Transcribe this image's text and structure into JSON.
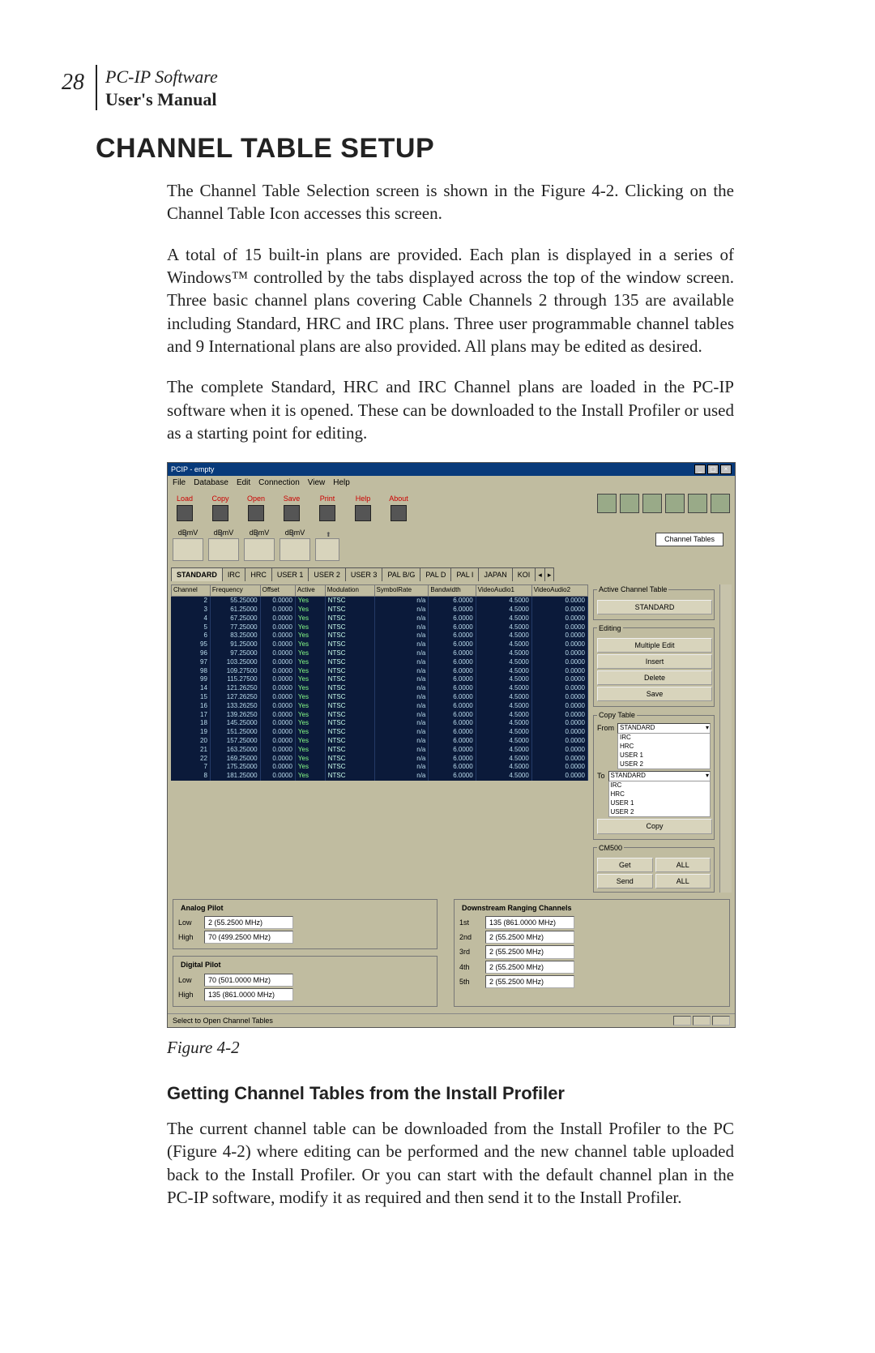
{
  "page_number": "28",
  "header": {
    "software": "PC-IP Software",
    "manual": "User's Manual"
  },
  "title": "CHANNEL TABLE SETUP",
  "paras": {
    "p1": "The Channel Table Selection screen is shown in the Figure 4-2. Clicking on the Channel Table Icon accesses this screen.",
    "p2": "A total of 15 built-in plans are provided. Each plan is displayed in a series of Windows™ controlled by the tabs displayed across the top of the window screen. Three basic channel plans covering Cable Channels 2 through 135 are available including Standard, HRC and IRC plans. Three user programmable channel tables and 9 International plans are also provided. All plans may be edited as desired.",
    "p3": "The complete Standard, HRC and IRC Channel plans are loaded in the PC-IP software when it is opened. These can be downloaded to the Install Profiler or used as a starting point for editing.",
    "p4": "The current channel table can be downloaded from the Install Profiler to the PC (Figure 4-2) where editing can be performed and the new channel table uploaded back to the Install Profiler. Or you can start with the default channel plan in the PC-IP software, modify it as required and then send it to the Install Profiler."
  },
  "figure_caption": "Figure 4-2",
  "sub_heading": "Getting Channel Tables from the Install Profiler",
  "win": {
    "title": "PCIP - empty",
    "controls": {
      "min": "_",
      "max": "▢",
      "close": "×"
    },
    "menus": [
      "File",
      "Database",
      "Edit",
      "Connection",
      "View",
      "Help"
    ],
    "toolbar": [
      "Load",
      "Copy",
      "Open",
      "Save",
      "Print",
      "Help",
      "About"
    ],
    "slot_labels": [
      "dBmV",
      "dBmV",
      "dBmV",
      "dBmV"
    ],
    "channel_tables_tooltip": "Channel Tables",
    "tabs": [
      "STANDARD",
      "IRC",
      "HRC",
      "USER 1",
      "USER 2",
      "USER 3",
      "PAL B/G",
      "PAL D",
      "PAL I",
      "JAPAN",
      "KOI"
    ],
    "thead": [
      "Channel",
      "Frequency",
      "Offset",
      "Active",
      "Modulation",
      "SymbolRate",
      "Bandwidth",
      "VideoAudio1",
      "VideoAudio2"
    ],
    "rows": [
      {
        "ch": "2",
        "freq": "55.25000",
        "off": "0.0000",
        "act": "Yes",
        "mod": "NTSC",
        "sym": "n/a",
        "bw": "6.0000",
        "va1": "4.5000",
        "va2": "0.0000"
      },
      {
        "ch": "3",
        "freq": "61.25000",
        "off": "0.0000",
        "act": "Yes",
        "mod": "NTSC",
        "sym": "n/a",
        "bw": "6.0000",
        "va1": "4.5000",
        "va2": "0.0000"
      },
      {
        "ch": "4",
        "freq": "67.25000",
        "off": "0.0000",
        "act": "Yes",
        "mod": "NTSC",
        "sym": "n/a",
        "bw": "6.0000",
        "va1": "4.5000",
        "va2": "0.0000"
      },
      {
        "ch": "5",
        "freq": "77.25000",
        "off": "0.0000",
        "act": "Yes",
        "mod": "NTSC",
        "sym": "n/a",
        "bw": "6.0000",
        "va1": "4.5000",
        "va2": "0.0000"
      },
      {
        "ch": "6",
        "freq": "83.25000",
        "off": "0.0000",
        "act": "Yes",
        "mod": "NTSC",
        "sym": "n/a",
        "bw": "6.0000",
        "va1": "4.5000",
        "va2": "0.0000"
      },
      {
        "ch": "95",
        "freq": "91.25000",
        "off": "0.0000",
        "act": "Yes",
        "mod": "NTSC",
        "sym": "n/a",
        "bw": "6.0000",
        "va1": "4.5000",
        "va2": "0.0000"
      },
      {
        "ch": "96",
        "freq": "97.25000",
        "off": "0.0000",
        "act": "Yes",
        "mod": "NTSC",
        "sym": "n/a",
        "bw": "6.0000",
        "va1": "4.5000",
        "va2": "0.0000"
      },
      {
        "ch": "97",
        "freq": "103.25000",
        "off": "0.0000",
        "act": "Yes",
        "mod": "NTSC",
        "sym": "n/a",
        "bw": "6.0000",
        "va1": "4.5000",
        "va2": "0.0000"
      },
      {
        "ch": "98",
        "freq": "109.27500",
        "off": "0.0000",
        "act": "Yes",
        "mod": "NTSC",
        "sym": "n/a",
        "bw": "6.0000",
        "va1": "4.5000",
        "va2": "0.0000"
      },
      {
        "ch": "99",
        "freq": "115.27500",
        "off": "0.0000",
        "act": "Yes",
        "mod": "NTSC",
        "sym": "n/a",
        "bw": "6.0000",
        "va1": "4.5000",
        "va2": "0.0000"
      },
      {
        "ch": "14",
        "freq": "121.26250",
        "off": "0.0000",
        "act": "Yes",
        "mod": "NTSC",
        "sym": "n/a",
        "bw": "6.0000",
        "va1": "4.5000",
        "va2": "0.0000"
      },
      {
        "ch": "15",
        "freq": "127.26250",
        "off": "0.0000",
        "act": "Yes",
        "mod": "NTSC",
        "sym": "n/a",
        "bw": "6.0000",
        "va1": "4.5000",
        "va2": "0.0000"
      },
      {
        "ch": "16",
        "freq": "133.26250",
        "off": "0.0000",
        "act": "Yes",
        "mod": "NTSC",
        "sym": "n/a",
        "bw": "6.0000",
        "va1": "4.5000",
        "va2": "0.0000"
      },
      {
        "ch": "17",
        "freq": "139.26250",
        "off": "0.0000",
        "act": "Yes",
        "mod": "NTSC",
        "sym": "n/a",
        "bw": "6.0000",
        "va1": "4.5000",
        "va2": "0.0000"
      },
      {
        "ch": "18",
        "freq": "145.25000",
        "off": "0.0000",
        "act": "Yes",
        "mod": "NTSC",
        "sym": "n/a",
        "bw": "6.0000",
        "va1": "4.5000",
        "va2": "0.0000"
      },
      {
        "ch": "19",
        "freq": "151.25000",
        "off": "0.0000",
        "act": "Yes",
        "mod": "NTSC",
        "sym": "n/a",
        "bw": "6.0000",
        "va1": "4.5000",
        "va2": "0.0000"
      },
      {
        "ch": "20",
        "freq": "157.25000",
        "off": "0.0000",
        "act": "Yes",
        "mod": "NTSC",
        "sym": "n/a",
        "bw": "6.0000",
        "va1": "4.5000",
        "va2": "0.0000"
      },
      {
        "ch": "21",
        "freq": "163.25000",
        "off": "0.0000",
        "act": "Yes",
        "mod": "NTSC",
        "sym": "n/a",
        "bw": "6.0000",
        "va1": "4.5000",
        "va2": "0.0000"
      },
      {
        "ch": "22",
        "freq": "169.25000",
        "off": "0.0000",
        "act": "Yes",
        "mod": "NTSC",
        "sym": "n/a",
        "bw": "6.0000",
        "va1": "4.5000",
        "va2": "0.0000"
      },
      {
        "ch": "7",
        "freq": "175.25000",
        "off": "0.0000",
        "act": "Yes",
        "mod": "NTSC",
        "sym": "n/a",
        "bw": "6.0000",
        "va1": "4.5000",
        "va2": "0.0000"
      },
      {
        "ch": "8",
        "freq": "181.25000",
        "off": "0.0000",
        "act": "Yes",
        "mod": "NTSC",
        "sym": "n/a",
        "bw": "6.0000",
        "va1": "4.5000",
        "va2": "0.0000"
      }
    ],
    "side": {
      "active_title": "Active Channel Table",
      "active_value": "STANDARD",
      "editing_title": "Editing",
      "editing_buttons": [
        "Multiple Edit",
        "Insert",
        "Delete",
        "Save"
      ],
      "copy_title": "Copy Table",
      "from_label": "From",
      "to_label": "To",
      "from_selected": "STANDARD",
      "from_options": [
        "IRC",
        "HRC",
        "USER 1",
        "USER 2"
      ],
      "to_selected": "STANDARD",
      "to_options": [
        "IRC",
        "HRC",
        "USER 1",
        "USER 2"
      ],
      "copy_button": "Copy",
      "cm500_title": "CM500",
      "cm500_get": "Get",
      "cm500_send": "Send",
      "cm500_all": "ALL"
    },
    "bottom": {
      "analog_title": "Analog Pilot",
      "digital_title": "Digital Pilot",
      "down_title": "Downstream Ranging Channels",
      "labels": {
        "low": "Low",
        "high": "High",
        "first": "1st",
        "second": "2nd",
        "third": "3rd",
        "fourth": "4th",
        "fifth": "5th"
      },
      "analog_low": "2 (55.2500 MHz)",
      "analog_high": "70 (499.2500 MHz)",
      "digital_low": "70 (501.0000 MHz)",
      "digital_high": "135 (861.0000 MHz)",
      "dr1": "135 (861.0000 MHz)",
      "dr2": "2 (55.2500 MHz)",
      "dr3": "2 (55.2500 MHz)",
      "dr4": "2 (55.2500 MHz)",
      "dr5": "2 (55.2500 MHz)"
    },
    "status": "Select to Open Channel Tables"
  }
}
